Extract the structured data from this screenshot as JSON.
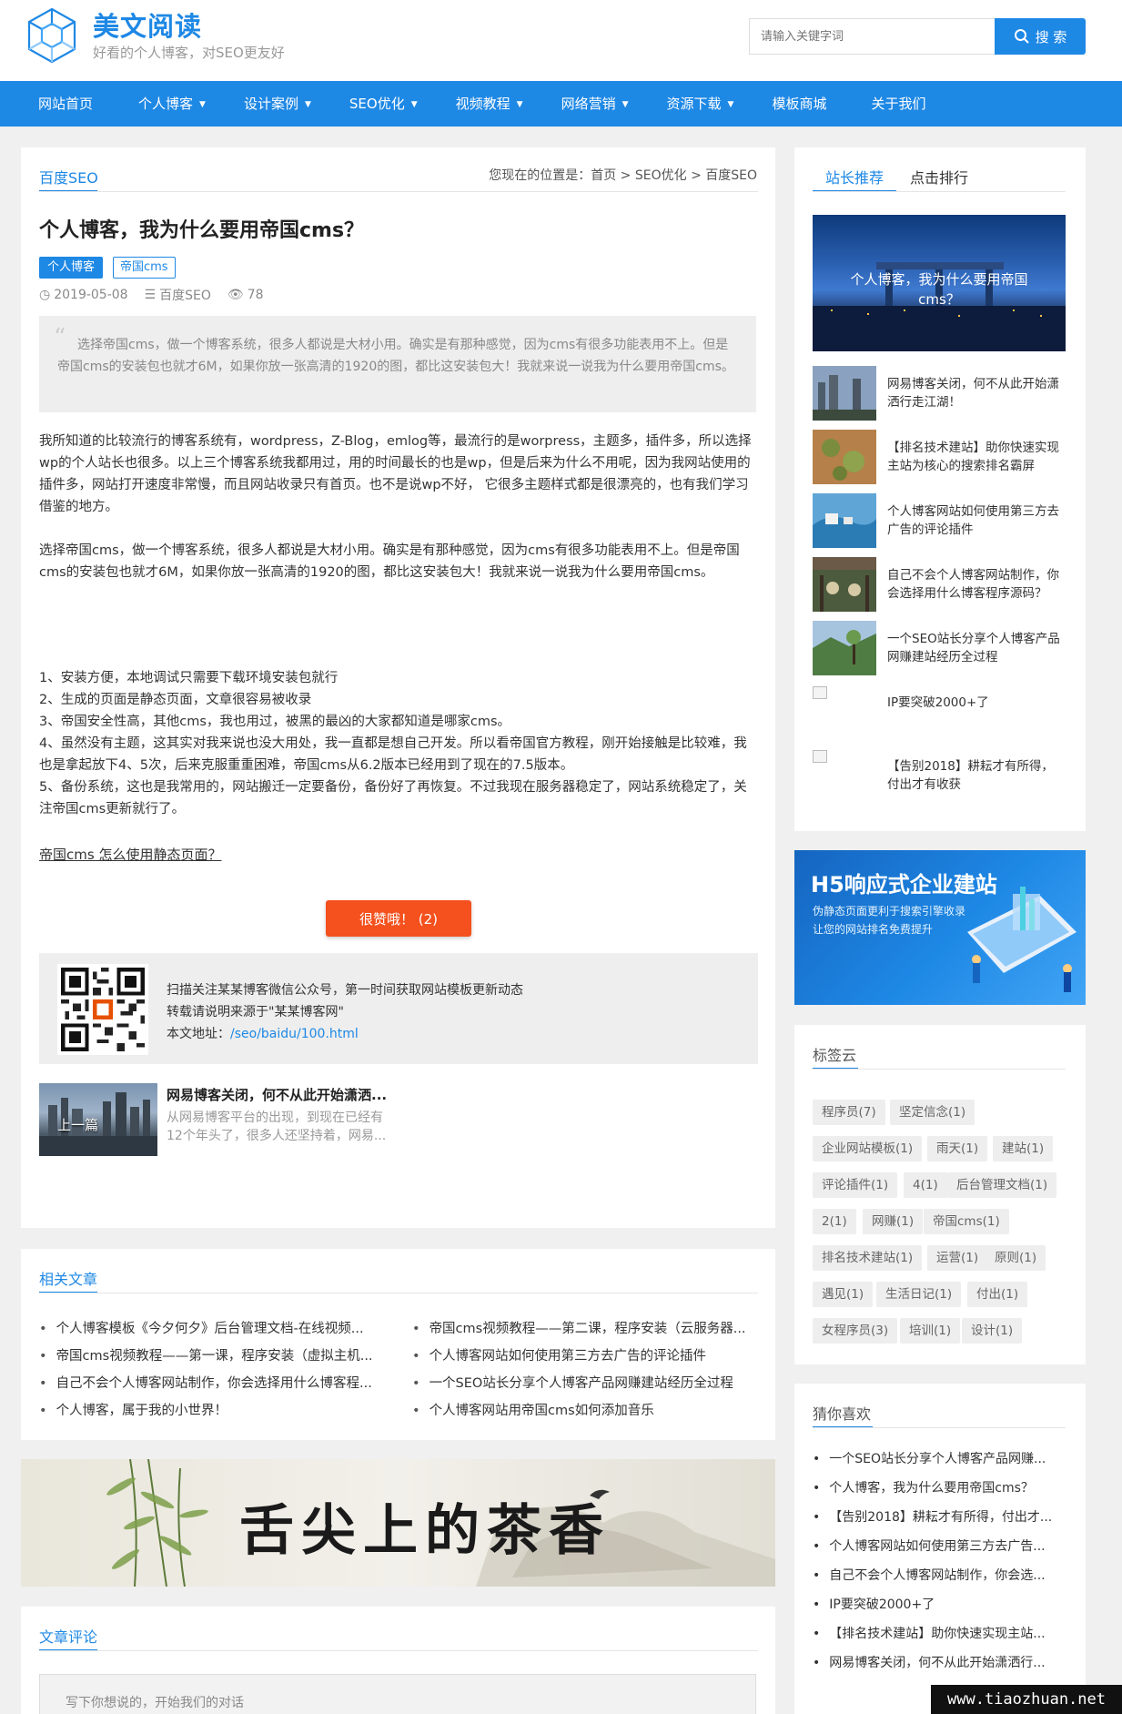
{
  "site": {
    "title": "美文阅读",
    "slogan": "好看的个人博客，对SEO更友好"
  },
  "search": {
    "placeholder": "请输入关键字词",
    "button_label": "搜 索"
  },
  "nav": [
    {
      "label": "网站首页",
      "dropdown": false
    },
    {
      "label": "个人博客",
      "dropdown": true
    },
    {
      "label": "设计案例",
      "dropdown": true
    },
    {
      "label": "SEO优化",
      "dropdown": true
    },
    {
      "label": "视频教程",
      "dropdown": true
    },
    {
      "label": "网络营销",
      "dropdown": true
    },
    {
      "label": "资源下载",
      "dropdown": true
    },
    {
      "label": "模板商城",
      "dropdown": false
    },
    {
      "label": "关于我们",
      "dropdown": false
    }
  ],
  "article": {
    "category": "百度SEO",
    "breadcrumb": "您现在的位置是：首页 > SEO优化 > 百度SEO",
    "title": "个人博客，我为什么要用帝国cms？",
    "tags": [
      "个人博客",
      "帝国cms"
    ],
    "date": "2019-05-08",
    "meta_category": "百度SEO",
    "views": "78",
    "summary": "选择帝国cms，做一个博客系统，很多人都说是大材小用。确实是有那种感觉，因为cms有很多功能表用不上。但是帝国cms的安装包也就才6M，如果你放一张高清的1920的图，都比这安装包大！我就来说一说我为什么要用帝国cms。",
    "para1": "我所知道的比较流行的博客系统有，wordpress，Z-Blog，emlog等，最流行的是worpress，主题多，插件多，所以选择wp的个人站长也很多。以上三个博客系统我都用过，用的时间最长的也是wp，但是后来为什么不用呢，因为我网站使用的插件多，网站打开速度非常慢，而且网站收录只有首页。也不是说wp不好， 它很多主题样式都是很漂亮的，也有我们学习借鉴的地方。",
    "para2": "选择帝国cms，做一个博客系统，很多人都说是大材小用。确实是有那种感觉，因为cms有很多功能表用不上。但是帝国cms的安装包也就才6M，如果你放一张高清的1920的图，都比这安装包大！我就来说一说我为什么要用帝国cms。",
    "list": [
      "1、安装方便，本地调试只需要下载环境安装包就行",
      "2、生成的页面是静态页面，文章很容易被收录",
      "3、帝国安全性高，其他cms，我也用过，被黑的最凶的大家都知道是哪家cms。",
      "4、虽然没有主题，这其实对我来说也没大用处，我一直都是想自己开发。所以看帝国官方教程，刚开始接触是比较难，我也是拿起放下4、5次，后来克服重重困难，帝国cms从6.2版本已经用到了现在的7.5版本。",
      "5、备份系统，这也是我常用的，网站搬迁一定要备份，备份好了再恢复。不过我现在服务器稳定了，网站系统稳定了，关注帝国cms更新就行了。"
    ],
    "link_text": "帝国cms 怎么使用静态页面？",
    "like_label": "很赞哦！ (2)",
    "share_line1": "扫描关注某某博客微信公众号，第一时间获取网站模板更新动态",
    "share_line2": "转载请说明来源于\"某某博客网\"",
    "share_url_label": "本文地址：",
    "share_url": "/seo/baidu/100.html",
    "prev_label": "上一篇",
    "prev_title": "网易博客关闭，何不从此开始潇洒...",
    "prev_desc": "从网易博客平台的出现，到现在已经有12个年头了，很多人还坚持着，网易..."
  },
  "related": {
    "title": "相关文章",
    "items": [
      "个人博客模板《今夕何夕》后台管理文档-在线视频...",
      "帝国cms视频教程——第二课，程序安装（云服务器...",
      "帝国cms视频教程——第一课，程序安装（虚拟主机...",
      "个人博客网站如何使用第三方去广告的评论插件",
      "自己不会个人博客网站制作，你会选择用什么博客程...",
      "一个SEO站长分享个人博客产品网赚建站经历全过程",
      "个人博客，属于我的小世界！",
      "个人博客网站用帝国cms如何添加音乐"
    ]
  },
  "comments": {
    "title": "文章评论",
    "placeholder": "写下你想说的，开始我们的对话"
  },
  "sidebar": {
    "tabs": [
      "站长推荐",
      "点击排行"
    ],
    "feature_title": "个人博客，我为什么要用帝国cms？",
    "list": [
      "网易博客关闭，何不从此开始潇洒行走江湖！",
      "【排名技术建站】助你快速实现主站为核心的搜索排名霸屏",
      "个人博客网站如何使用第三方去广告的评论插件",
      "自己不会个人博客网站制作，你会选择用什么博客程序源码？",
      "一个SEO站长分享个人博客产品网赚建站经历全过程",
      "IP要突破2000+了",
      "【告别2018】耕耘才有所得，付出才有收获"
    ],
    "h5_title": "H5响应式企业建站",
    "h5_line1": "伪静态页面更利于搜索引擎收录",
    "h5_line2": "让您的网站排名免费提升",
    "tagcloud_title": "标签云",
    "tags": [
      "程序员(7)",
      "坚定信念(1)",
      "企业网站模板(1)",
      "雨天(1)",
      "建站(1)",
      "评论插件(1)",
      "4(1)",
      "后台管理文档(1)",
      "2(1)",
      "网赚(1)",
      "帝国cms(1)",
      "排名技术建站(1)",
      "运营(1)",
      "原则(1)",
      "遇见(1)",
      "生活日记(1)",
      "付出(1)",
      "女程序员(3)",
      "培训(1)",
      "设计(1)"
    ],
    "guess_title": "猜你喜欢",
    "guess": [
      "一个SEO站长分享个人博客产品网赚...",
      "个人博客，我为什么要用帝国cms？",
      "【告别2018】耕耘才有所得，付出才...",
      "个人博客网站如何使用第三方去广告...",
      "自己不会个人博客网站制作，你会选...",
      "IP要突破2000+了",
      "【排名技术建站】助你快速实现主站...",
      "网易博客关闭，何不从此开始潇洒行..."
    ]
  },
  "tea_banner_text": "舌尖上的茶香",
  "watermark": "www.tiaozhuan.net",
  "colors": {
    "accent": "#1e88e5",
    "like_button": "#f4511e"
  }
}
